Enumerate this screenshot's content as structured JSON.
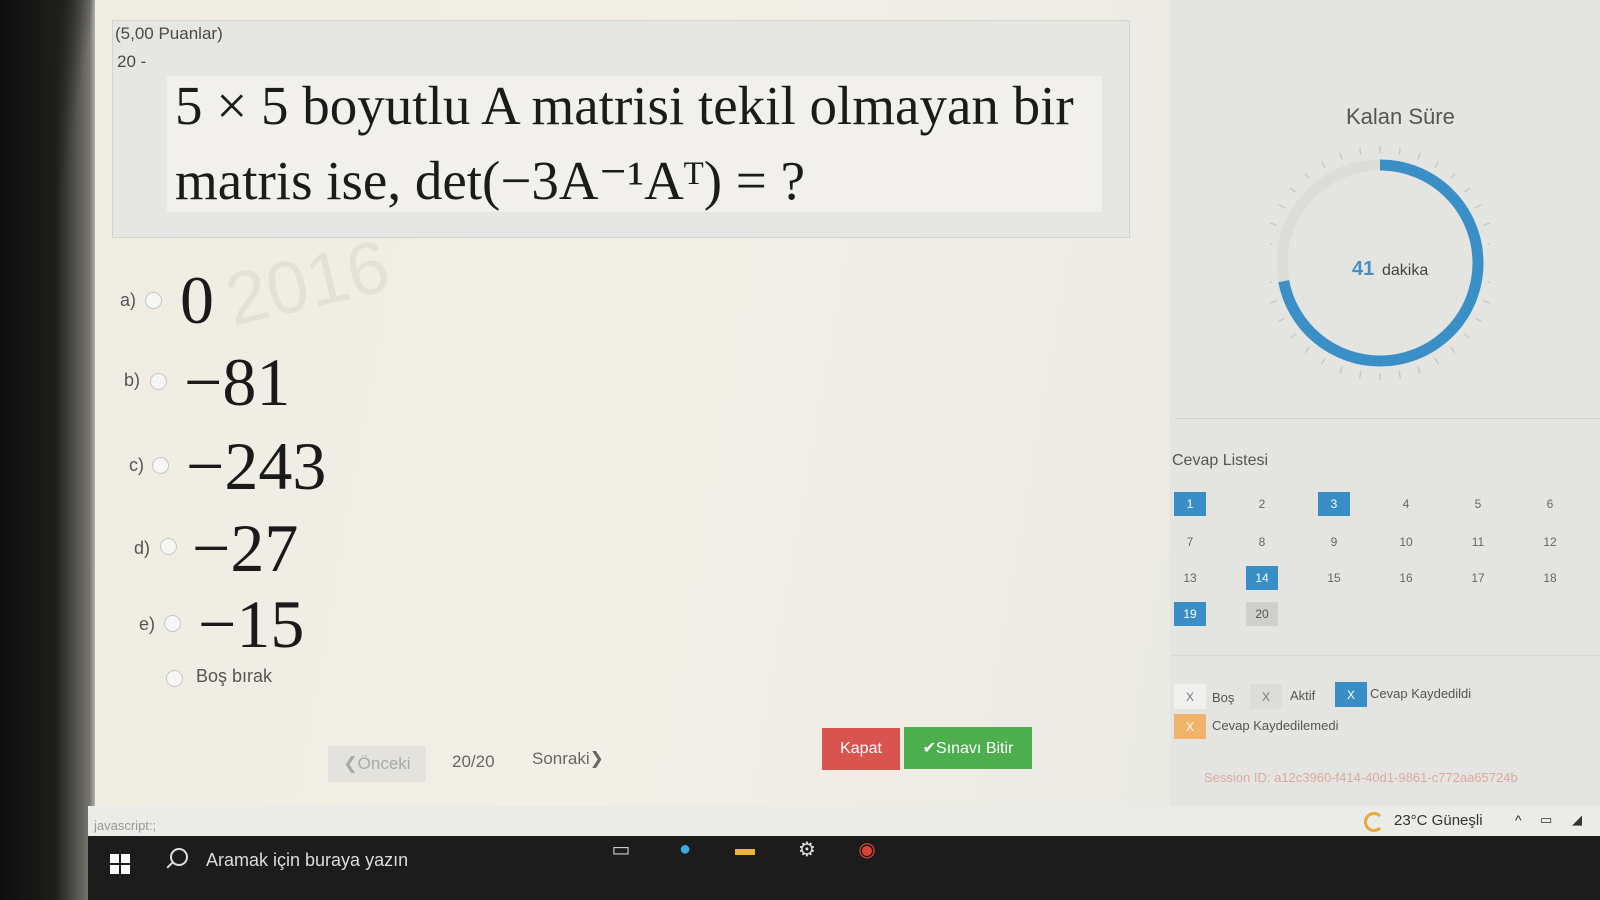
{
  "question": {
    "points": "(5,00 Puanlar)",
    "number": "20 -",
    "line1": "5 × 5 boyutlu A matrisi tekil olmayan bir",
    "line2": "matris ise, det(−3A⁻¹Aᵀ) = ?"
  },
  "watermark": "2016",
  "options": [
    {
      "letter": "a)",
      "value": "0"
    },
    {
      "letter": "b)",
      "value": "−81"
    },
    {
      "letter": "c)",
      "value": "−243"
    },
    {
      "letter": "d)",
      "value": "−27"
    },
    {
      "letter": "e)",
      "value": "−15"
    }
  ],
  "blank_option": "Boş bırak",
  "nav": {
    "prev": "❮Önceki",
    "page": "20/20",
    "next": "Sonraki❯",
    "close": "Kapat",
    "finish": "✔Sınavı Bitir"
  },
  "timer": {
    "title": "Kalan Süre",
    "value": "41",
    "unit": "dakika",
    "remaining_fraction": 0.72,
    "color": "#3b8fc7"
  },
  "answer_list": {
    "title": "Cevap Listesi",
    "items": [
      {
        "label": "1",
        "state": "saved"
      },
      {
        "label": "2",
        "state": "empty"
      },
      {
        "label": "3",
        "state": "saved"
      },
      {
        "label": "4",
        "state": "empty"
      },
      {
        "label": "5",
        "state": "empty"
      },
      {
        "label": "6",
        "state": "empty"
      },
      {
        "label": "7",
        "state": "empty"
      },
      {
        "label": "8",
        "state": "empty"
      },
      {
        "label": "9",
        "state": "empty"
      },
      {
        "label": "10",
        "state": "empty"
      },
      {
        "label": "11",
        "state": "empty"
      },
      {
        "label": "12",
        "state": "empty"
      },
      {
        "label": "13",
        "state": "empty"
      },
      {
        "label": "14",
        "state": "saved"
      },
      {
        "label": "15",
        "state": "empty"
      },
      {
        "label": "16",
        "state": "empty"
      },
      {
        "label": "17",
        "state": "empty"
      },
      {
        "label": "18",
        "state": "empty"
      },
      {
        "label": "19",
        "state": "saved"
      },
      {
        "label": "20",
        "state": "active"
      }
    ]
  },
  "legend": {
    "mark": "X",
    "empty": "Boş",
    "active": "Aktif",
    "saved": "Cevap Kaydedildi",
    "not_saved": "Cevap Kaydedilemedi",
    "colors": {
      "saved": "#3a8ec6",
      "not_saved": "#f0b36b",
      "active": "#cfcfcb"
    }
  },
  "session": "Session ID: a12c3960-f414-40d1-9861-c772aa65724b",
  "status_bar": "javascript:;",
  "taskbar": {
    "search_placeholder": "Aramak için buraya yazın",
    "weather": "23°C Güneşli",
    "tray_chevron": "^"
  }
}
